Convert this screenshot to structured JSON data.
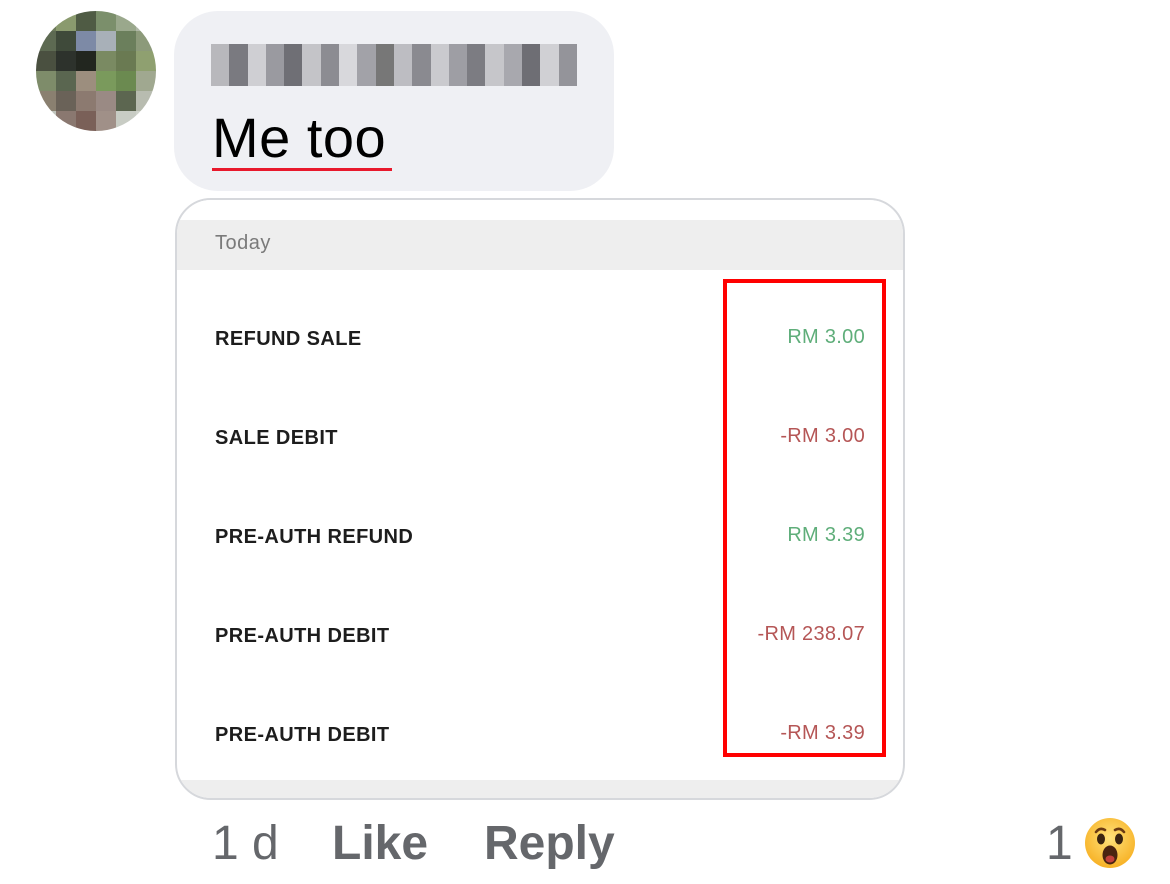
{
  "comment": {
    "text": "Me too"
  },
  "attachment": {
    "section_header": "Today",
    "rows": [
      {
        "label": "REFUND SALE",
        "amount": "RM 3.00",
        "type": "credit"
      },
      {
        "label": "SALE DEBIT",
        "amount": "-RM 3.00",
        "type": "debit"
      },
      {
        "label": "PRE-AUTH REFUND",
        "amount": "RM 3.39",
        "type": "credit"
      },
      {
        "label": "PRE-AUTH DEBIT",
        "amount": "-RM 238.07",
        "type": "debit"
      },
      {
        "label": "PRE-AUTH DEBIT",
        "amount": "-RM 3.39",
        "type": "debit"
      }
    ]
  },
  "footer": {
    "time": "1 d",
    "like_label": "Like",
    "reply_label": "Reply",
    "reaction_count": "1",
    "reaction_icon": "wow-emoji-icon"
  },
  "colors": {
    "credit": "#5fae7a",
    "debit": "#b55656",
    "highlight": "#ff0000",
    "bubble": "#eff0f4"
  }
}
